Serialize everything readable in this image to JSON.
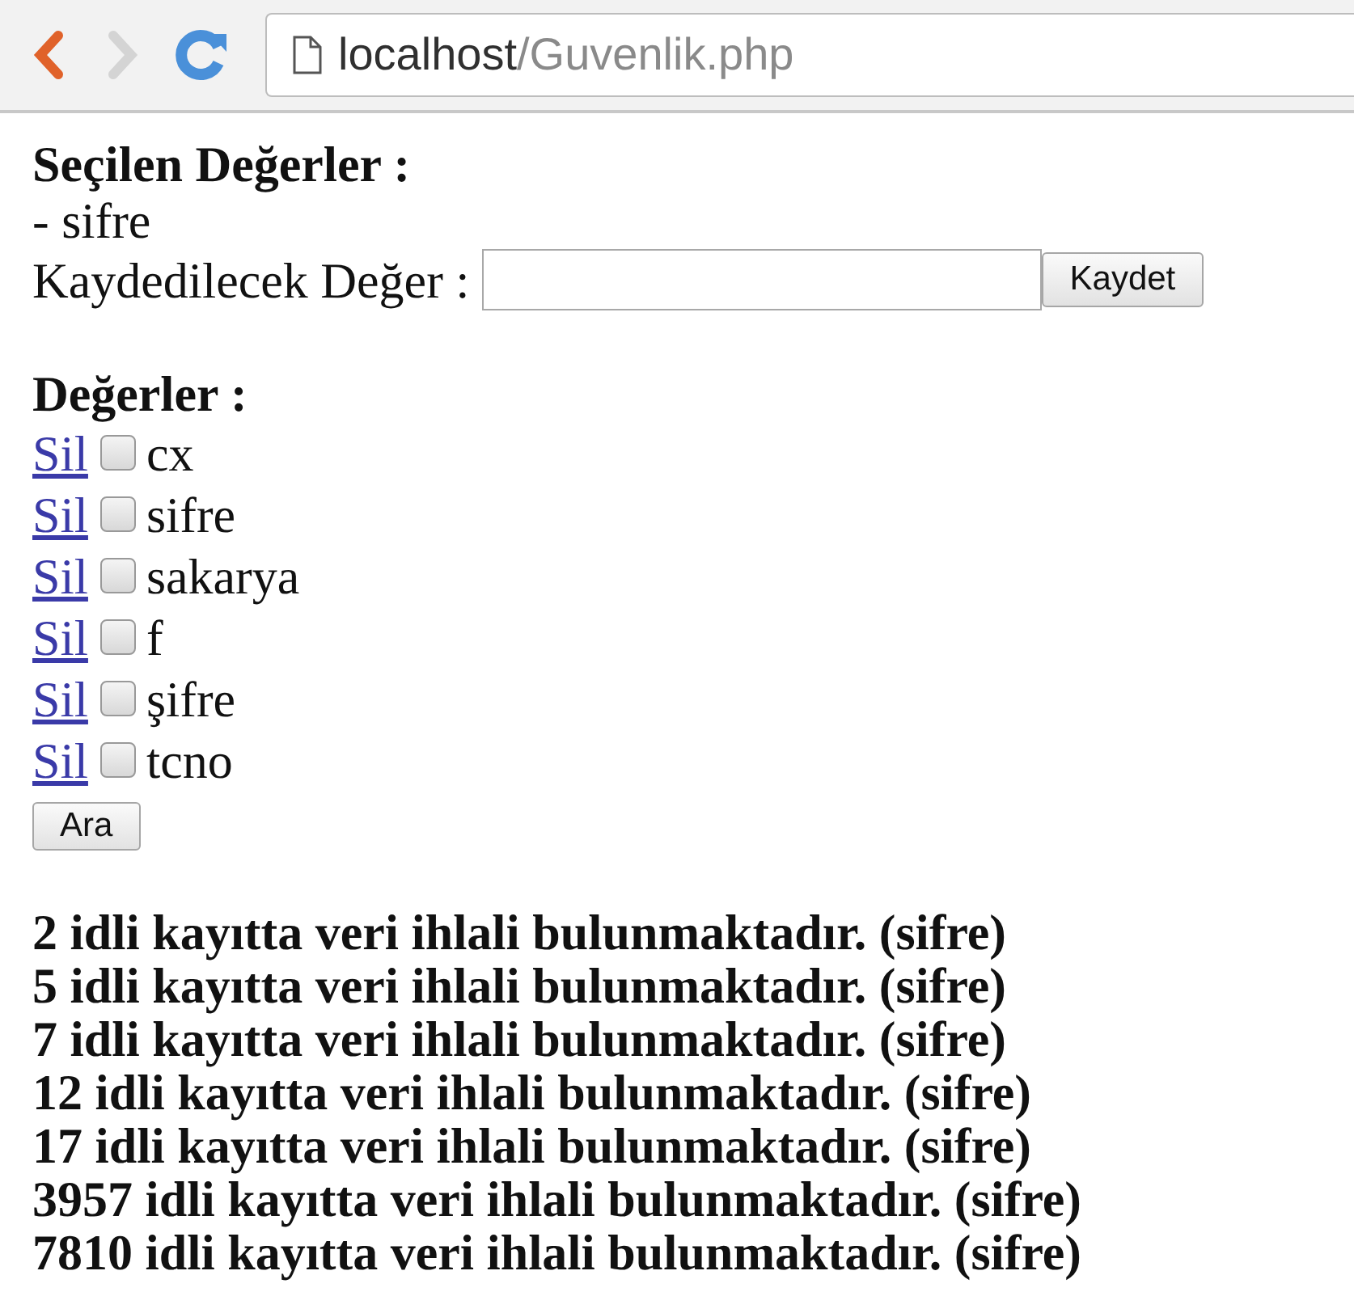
{
  "browser": {
    "url_host": "localhost",
    "url_path": "/Guvenlik.php"
  },
  "selected": {
    "heading": "Seçilen Değerler :",
    "items": [
      "- sifre"
    ]
  },
  "save": {
    "label": "Kaydedilecek Değer :",
    "button": "Kaydet"
  },
  "values": {
    "heading": "Değerler :",
    "items": [
      {
        "link": "Sil",
        "checked": false,
        "name": "cx"
      },
      {
        "link": "Sil",
        "checked": false,
        "name": "sifre"
      },
      {
        "link": "Sil",
        "checked": false,
        "name": "sakarya"
      },
      {
        "link": "Sil",
        "checked": false,
        "name": "f"
      },
      {
        "link": "Sil",
        "checked": false,
        "name": "şifre"
      },
      {
        "link": "Sil",
        "checked": false,
        "name": "tcno"
      }
    ],
    "button": "Ara"
  },
  "results": [
    "2 idli kayıtta veri ihlali bulunmaktadır. (sifre)",
    "5 idli kayıtta veri ihlali bulunmaktadır. (sifre)",
    "7 idli kayıtta veri ihlali bulunmaktadır. (sifre)",
    "12 idli kayıtta veri ihlali bulunmaktadır. (sifre)",
    "17 idli kayıtta veri ihlali bulunmaktadır. (sifre)",
    "3957 idli kayıtta veri ihlali bulunmaktadır. (sifre)",
    "7810 idli kayıtta veri ihlali bulunmaktadır. (sifre)"
  ]
}
